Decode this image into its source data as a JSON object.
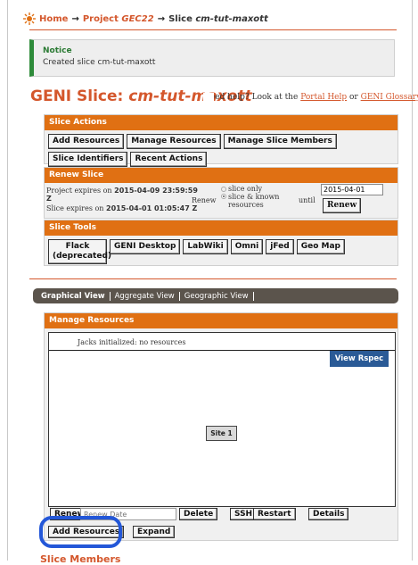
{
  "breadcrumb": {
    "home": "Home",
    "arrow": "→",
    "project_prefix": "Project",
    "project_name": "GEC22",
    "slice_prefix": "Slice",
    "slice_name": "cm-tut-maxott"
  },
  "notice": {
    "title": "Notice",
    "message": "Created slice cm-tut-maxott"
  },
  "title": {
    "prefix": "GENI Slice:",
    "name": "cm-tut-maxott"
  },
  "help": {
    "lead": "Need help? Look at the",
    "portal_help": "Portal Help",
    "or": "or",
    "glossary": "GENI Glossary",
    "end": "."
  },
  "slice_actions": {
    "header": "Slice Actions",
    "buttons": [
      "Add Resources",
      "Manage Resources",
      "Manage Slice Members",
      "Slice Identifiers",
      "Recent Actions"
    ]
  },
  "renew": {
    "header": "Renew Slice",
    "project_expires_label": "Project expires on",
    "project_expires_value": "2015-04-09 23:59:59",
    "tz": "Z",
    "slice_expires_label": "Slice expires on",
    "slice_expires_value": "2015-04-01 01:05:47 Z",
    "renew_label": "Renew",
    "option_slice_only": "slice only",
    "option_slice_known": "slice & known resources",
    "selected_option": "slice & known resources",
    "until_label": "until",
    "date_value": "2015-04-01",
    "button": "Renew"
  },
  "slice_tools": {
    "header": "Slice Tools",
    "buttons": [
      "Flack (deprecated)",
      "GENI Desktop",
      "LabWiki",
      "Omni",
      "jFed",
      "Geo Map"
    ]
  },
  "view_tabs": [
    "Graphical View",
    "Aggregate View",
    "Geographic View"
  ],
  "manage": {
    "header": "Manage Resources",
    "status": "Jacks initialized: no resources",
    "view_rspec": "View Rspec",
    "site": "Site 1",
    "renew": "Renew",
    "date_placeholder": "Renew Date",
    "delete": "Delete",
    "ssh": "SSH",
    "restart": "Restart",
    "details": "Details",
    "add_resources": "Add Resources",
    "expand": "Expand"
  },
  "slice_members_heading": "Slice Members",
  "colors": {
    "accent": "#d4572c",
    "header_orange": "#e07013",
    "notice_green": "#2e8b3a",
    "rspec_blue": "#2a5a96",
    "highlight_blue": "#2357d8"
  },
  "icons": [
    "geni-logo-icon"
  ]
}
